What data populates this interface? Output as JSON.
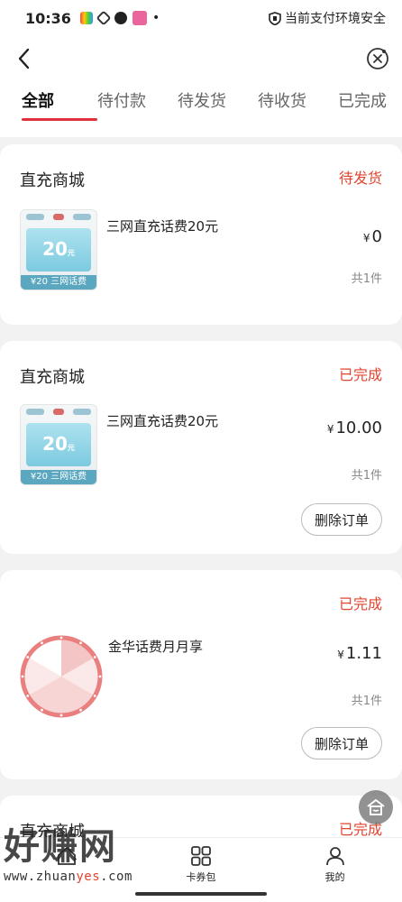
{
  "statusbar": {
    "time": "10:36",
    "dot": "•",
    "security_text": "当前支付环境安全"
  },
  "tabs": [
    "全部",
    "待付款",
    "待发货",
    "待收货",
    "已完成"
  ],
  "orders": [
    {
      "shop": "直充商城",
      "status": "待发货",
      "product": "三网直充话费20元",
      "price": "0",
      "count": "共1件",
      "thumb": {
        "value": "20",
        "unit": "元",
        "strip": "¥20 三网话费"
      }
    },
    {
      "shop": "直充商城",
      "status": "已完成",
      "product": "三网直充话费20元",
      "price": "10.00",
      "count": "共1件",
      "button": "删除订单",
      "thumb": {
        "value": "20",
        "unit": "元",
        "strip": "¥20 三网话费"
      }
    },
    {
      "shop": "",
      "status": "已完成",
      "product": "金华话费月月享",
      "price": "1.11",
      "count": "共1件",
      "button": "删除订单"
    },
    {
      "shop": "直充商城",
      "status": "已完成"
    }
  ],
  "currency": "¥",
  "tabbar": [
    {
      "label": "",
      "icon": "home-icon"
    },
    {
      "label": "卡券包",
      "icon": "grid-icon"
    },
    {
      "label": "我的",
      "icon": "person-icon"
    }
  ],
  "watermark": {
    "big": "好赚网",
    "small_a": "www.zhuan",
    "small_b": "yes",
    "small_c": ".com"
  },
  "colors": {
    "accent": "#e0303c",
    "status": "#e2452f",
    "thumb": "#7ccae0"
  }
}
